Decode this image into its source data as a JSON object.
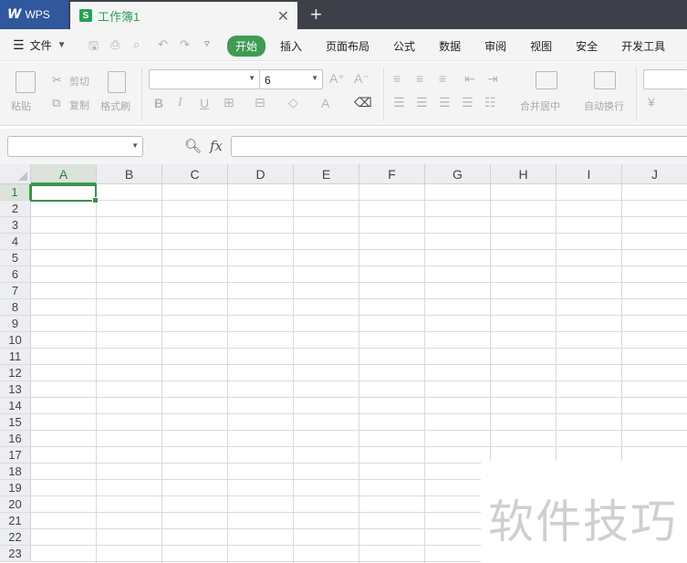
{
  "titlebar": {
    "app_tab_label": "WPS",
    "doc_tab_icon_letter": "S",
    "doc_tab_label": "工作簿1",
    "close_glyph": "✕",
    "new_tab_glyph": "+"
  },
  "menubar": {
    "file_label": "文件",
    "tabs": [
      "开始",
      "插入",
      "页面布局",
      "公式",
      "数据",
      "审阅",
      "视图",
      "安全",
      "开发工具"
    ],
    "active_tab": "开始"
  },
  "ribbon": {
    "paste_label": "粘贴",
    "cut_label": "剪切",
    "copy_label": "复制",
    "format_painter_label": "格式刷",
    "font_name_value": "",
    "font_size_value": "6",
    "grow_font": "A⁺",
    "shrink_font": "A⁻",
    "bold": "B",
    "italic": "I",
    "underline": "U",
    "font_color": "A",
    "merge_center_label": "合并居中",
    "wrap_text_label": "自动换行",
    "currency_symbol": "¥"
  },
  "formula_bar": {
    "name_box_value": "",
    "fx_label": "fx",
    "formula_value": ""
  },
  "sheet": {
    "columns": [
      "A",
      "B",
      "C",
      "D",
      "E",
      "F",
      "G",
      "H",
      "I",
      "J"
    ],
    "rows": [
      "1",
      "2",
      "3",
      "4",
      "5",
      "6",
      "7",
      "8",
      "9",
      "10",
      "11",
      "12",
      "13",
      "14",
      "15",
      "16",
      "17",
      "18",
      "19",
      "20",
      "21",
      "22",
      "23"
    ],
    "selected_cell": "A1"
  },
  "watermark": {
    "text": "软件技巧"
  },
  "colors": {
    "accent_green": "#3f9b53",
    "wps_blue": "#31579c",
    "titlebar_dark": "#3d4048"
  }
}
